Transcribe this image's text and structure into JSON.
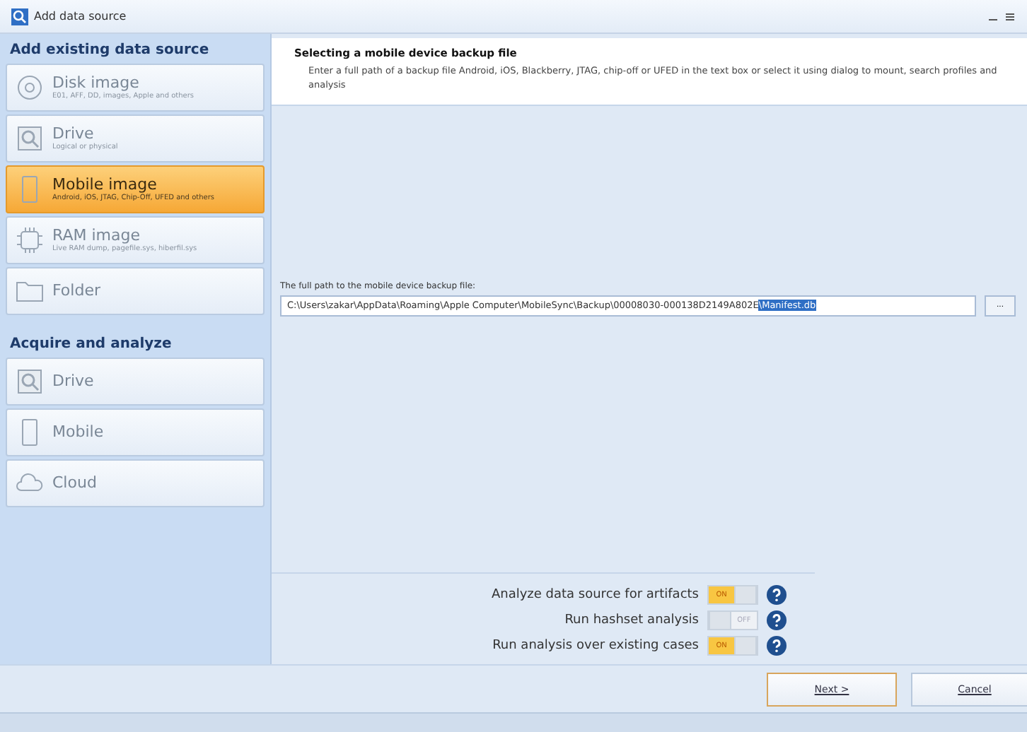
{
  "window": {
    "title": "Add data source"
  },
  "sidebar": {
    "sections": [
      {
        "title": "Add existing data source",
        "items": [
          {
            "kind": "disk",
            "label": "Disk image",
            "sublabel": "E01, AFF, DD, images, Apple and others",
            "selected": false
          },
          {
            "kind": "drive",
            "label": "Drive",
            "sublabel": "Logical or physical",
            "selected": false
          },
          {
            "kind": "mobile",
            "label": "Mobile image",
            "sublabel": "Android, iOS, JTAG, Chip-Off, UFED and others",
            "selected": true
          },
          {
            "kind": "ram",
            "label": "RAM image",
            "sublabel": "Live RAM dump, pagefile.sys, hiberfil.sys",
            "selected": false
          },
          {
            "kind": "folder",
            "label": "Folder",
            "selected": false
          }
        ]
      },
      {
        "title": "Acquire and analyze",
        "items": [
          {
            "kind": "drive",
            "label": "Drive",
            "selected": false
          },
          {
            "kind": "mobile",
            "label": "Mobile",
            "selected": false
          },
          {
            "kind": "cloud",
            "label": "Cloud",
            "selected": false
          }
        ]
      }
    ]
  },
  "header": {
    "title": "Selecting a mobile device backup file",
    "description": "Enter a full path of a backup file Android, iOS, Blackberry, JTAG, chip-off or UFED in the text box or select it using dialog to mount, search profiles and analysis"
  },
  "path_field": {
    "label": "The full path to the mobile device backup file:",
    "value": "C:\\Users\\zakar\\AppData\\Roaming\\Apple Computer\\MobileSync\\Backup\\00008030-000138D2149A802E",
    "selection": "\\Manifest.db",
    "browse": "..."
  },
  "options": [
    {
      "label": "Analyze data source for artifacts",
      "on": true,
      "text": "ON"
    },
    {
      "label": "Run hashset analysis",
      "on": false,
      "text": "OFF"
    },
    {
      "label": "Run analysis over existing cases",
      "on": true,
      "text": "ON"
    }
  ],
  "buttons": [
    {
      "label": "Next >",
      "default": true
    },
    {
      "label": "Cancel",
      "default": false
    }
  ]
}
